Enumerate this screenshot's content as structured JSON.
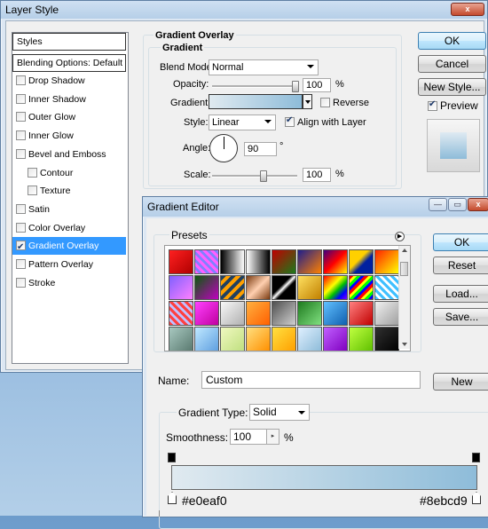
{
  "layer_style": {
    "title": "Layer Style",
    "close_glyph": "x",
    "styles_header": "Styles",
    "blending": "Blending Options: Default",
    "items": [
      {
        "label": "Drop Shadow",
        "checked": false,
        "indent": false
      },
      {
        "label": "Inner Shadow",
        "checked": false,
        "indent": false
      },
      {
        "label": "Outer Glow",
        "checked": false,
        "indent": false
      },
      {
        "label": "Inner Glow",
        "checked": false,
        "indent": false
      },
      {
        "label": "Bevel and Emboss",
        "checked": false,
        "indent": false
      },
      {
        "label": "Contour",
        "checked": false,
        "indent": true
      },
      {
        "label": "Texture",
        "checked": false,
        "indent": true
      },
      {
        "label": "Satin",
        "checked": false,
        "indent": false
      },
      {
        "label": "Color Overlay",
        "checked": false,
        "indent": false
      },
      {
        "label": "Gradient Overlay",
        "checked": true,
        "indent": false,
        "selected": true
      },
      {
        "label": "Pattern Overlay",
        "checked": false,
        "indent": false
      },
      {
        "label": "Stroke",
        "checked": false,
        "indent": false
      }
    ],
    "section_title": "Gradient Overlay",
    "group_title": "Gradient",
    "blend_mode_label": "Blend Mode:",
    "blend_mode_value": "Normal",
    "opacity_label": "Opacity:",
    "opacity_value": "100",
    "opacity_unit": "%",
    "gradient_label": "Gradient:",
    "reverse_label": "Reverse",
    "style_label": "Style:",
    "style_value": "Linear",
    "align_label": "Align with Layer",
    "angle_label": "Angle:",
    "angle_value": "90",
    "angle_unit": "°",
    "scale_label": "Scale:",
    "scale_value": "100",
    "scale_unit": "%",
    "ok_label": "OK",
    "cancel_label": "Cancel",
    "new_style_label": "New Style...",
    "preview_label": "Preview"
  },
  "gradient_editor": {
    "title": "Gradient Editor",
    "presets_label": "Presets",
    "ok_label": "OK",
    "reset_label": "Reset",
    "load_label": "Load...",
    "save_label": "Save...",
    "name_label": "Name:",
    "name_value": "Custom",
    "new_label": "New",
    "gradient_type_label": "Gradient Type:",
    "gradient_type_value": "Solid",
    "smoothness_label": "Smoothness:",
    "smoothness_value": "100",
    "smoothness_unit": "%",
    "stop_left_color": "#e0eaf0",
    "stop_right_color": "#8ebcd9",
    "stop_left_label": "#e0eaf0",
    "stop_right_label": "#8ebcd9",
    "presets": [
      "linear-gradient(135deg,#ff2020,#b00000)",
      "repeating-linear-gradient(45deg,#ff60ff 0 3px,#8080ff 3px 6px)",
      "linear-gradient(90deg,#000,#fff)",
      "linear-gradient(90deg,#fff,#000)",
      "linear-gradient(135deg,#c00000,#1a7a1a)",
      "linear-gradient(135deg,#1e1e8c,#ff8000)",
      "linear-gradient(135deg,#400080,#ff0000,#ffff00)",
      "linear-gradient(135deg,#ffd000 40%,#0020a0 60%)",
      "linear-gradient(135deg,#ff2000,#ffff00)",
      "linear-gradient(135deg,#8060ff,#ff80ff)",
      "linear-gradient(135deg,#0a5a0a,#c000c0)",
      "repeating-linear-gradient(135deg,#204060 0 4px,#ffa000 4px 8px)",
      "linear-gradient(135deg,#7a3a10,#ffd0b0,#7a3a10)",
      "linear-gradient(135deg,#000 40%,#fff 50%,#000 60%)",
      "linear-gradient(135deg,#ffe060,#c08000)",
      "linear-gradient(135deg,#ff0000,#ff8000,#ffff00,#00c000,#0000ff,#8000ff)",
      "repeating-linear-gradient(135deg,#ff0000 0 3px,#ffff00 3px 6px,#00ff00 6px 9px,#0000ff 9px 12px)",
      "repeating-linear-gradient(45deg,#40c0ff 0 3px,#fff 3px 6px)",
      "repeating-linear-gradient(45deg,#ff4040 0 3px,#c0c0ff 3px 6px)",
      "linear-gradient(135deg,#ff40ff,#c000a0)",
      "linear-gradient(135deg,#f8f8f8,#b0b0b0)",
      "linear-gradient(135deg,#ffb040,#ff6000)",
      "linear-gradient(135deg,#505050,#d0d0d0)",
      "linear-gradient(135deg,#1f7a1f,#80e080)",
      "linear-gradient(135deg,#60c0ff,#1060b0)",
      "linear-gradient(135deg,#ff8080,#c00000)",
      "linear-gradient(135deg,#f0f0f0,#a0a0a0)",
      "linear-gradient(135deg,#a8c8c0,#5a7a70)",
      "linear-gradient(135deg,#c0e8ff,#60a0e0)",
      "linear-gradient(135deg,#f0f8c0,#c0e080)",
      "linear-gradient(135deg,#ffe080,#ff9000)",
      "linear-gradient(135deg,#ffe040,#ffa000)",
      "linear-gradient(135deg,#e0f0ff,#8ebcd9)",
      "linear-gradient(135deg,#c060ff,#8000c0)",
      "linear-gradient(135deg,#c0ff40,#60c000)",
      "linear-gradient(135deg,#303030,#000)"
    ],
    "icons": {
      "presets_menu": "circle-arrow-icon",
      "stop": "color-stop-icon",
      "opacity_stop": "opacity-stop-icon"
    }
  }
}
